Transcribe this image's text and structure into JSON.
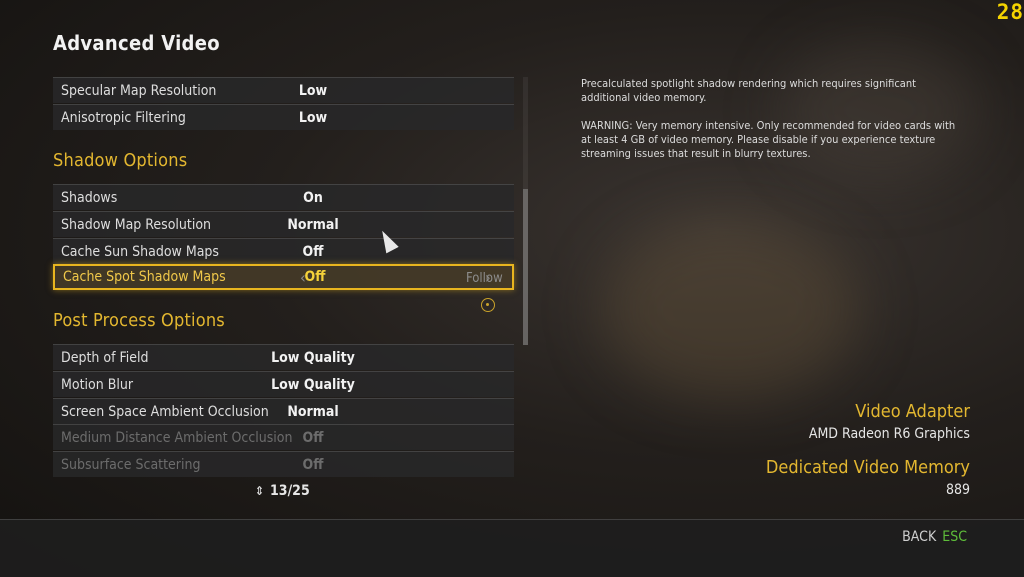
{
  "fps_counter": "28",
  "page": {
    "title": "Advanced Video"
  },
  "rows_top": [
    {
      "label": "Specular Map Resolution",
      "value": "Low"
    },
    {
      "label": "Anisotropic Filtering",
      "value": "Low"
    }
  ],
  "sections": {
    "shadow": "Shadow Options",
    "post": "Post Process Options"
  },
  "rows_shadow": [
    {
      "label": "Shadows",
      "value": "On"
    },
    {
      "label": "Shadow Map Resolution",
      "value": "Normal"
    },
    {
      "label": "Cache Sun Shadow Maps",
      "value": "Off"
    },
    {
      "label": "Cache Spot Shadow Maps",
      "value": "Off",
      "selected": true
    }
  ],
  "follow_hint": "Follow",
  "rows_post": [
    {
      "label": "Depth of Field",
      "value": "Low Quality"
    },
    {
      "label": "Motion Blur",
      "value": "Low Quality"
    },
    {
      "label": "Screen Space Ambient Occlusion",
      "value": "Normal"
    },
    {
      "label": "Medium Distance Ambient Occlusion",
      "value": "Off",
      "disabled": true
    },
    {
      "label": "Subsurface Scattering",
      "value": "Off",
      "disabled": true
    }
  ],
  "pager": {
    "text": "13/25"
  },
  "description": {
    "line1": "Precalculated spotlight shadow rendering which requires significant additional video memory.",
    "line2": "WARNING: Very memory intensive. Only recommended for video cards with at least 4 GB of video memory. Please disable if you experience texture streaming issues that result in blurry textures."
  },
  "adapter": {
    "heading": "Video Adapter",
    "value": "AMD Radeon R6 Graphics"
  },
  "memory": {
    "heading": "Dedicated Video Memory",
    "value": "889"
  },
  "footer": {
    "back_label": "BACK",
    "back_key": "ESC"
  },
  "colors": {
    "accent": "#e3b730",
    "selection": "#e8b51f",
    "esc_key": "#5ebd3a",
    "fps": "#f5d400"
  }
}
